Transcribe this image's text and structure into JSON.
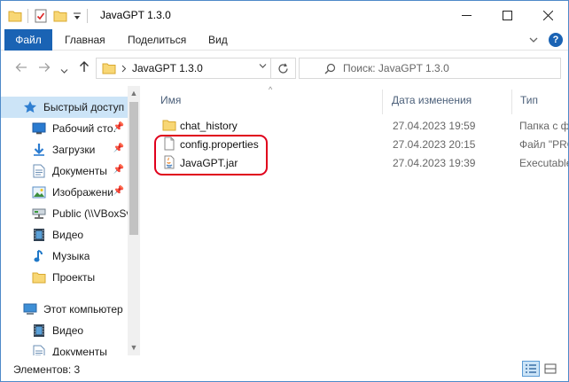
{
  "window": {
    "title": "JavaGPT 1.3.0"
  },
  "ribbon": {
    "file": "Файл",
    "tabs": [
      "Главная",
      "Поделиться",
      "Вид"
    ]
  },
  "nav": {
    "path": "JavaGPT 1.3.0",
    "search_placeholder": "Поиск: JavaGPT 1.3.0"
  },
  "sidebar": {
    "items": [
      {
        "label": "Быстрый доступ",
        "icon": "star-icon"
      },
      {
        "label": "Рабочий сто.",
        "icon": "desktop-icon"
      },
      {
        "label": "Загрузки",
        "icon": "download-icon"
      },
      {
        "label": "Документы",
        "icon": "documents-icon"
      },
      {
        "label": "Изображени",
        "icon": "pictures-icon"
      },
      {
        "label": "Public (\\\\VBoxSv",
        "icon": "network-drive-icon"
      },
      {
        "label": "Видео",
        "icon": "video-icon"
      },
      {
        "label": "Музыка",
        "icon": "music-icon"
      },
      {
        "label": "Проекты",
        "icon": "folder-icon"
      },
      {
        "label": "Этот компьютер",
        "icon": "computer-icon"
      },
      {
        "label": "Видео",
        "icon": "video-icon"
      },
      {
        "label": "Документы",
        "icon": "documents-icon"
      }
    ]
  },
  "columns": {
    "name": "Имя",
    "date": "Дата изменения",
    "type": "Тип"
  },
  "files": [
    {
      "name": "chat_history",
      "date": "27.04.2023 19:59",
      "type": "Папка с ф",
      "icon": "folder-icon"
    },
    {
      "name": "config.properties",
      "date": "27.04.2023 20:15",
      "type": "Файл \"PRO",
      "icon": "file-icon"
    },
    {
      "name": "JavaGPT.jar",
      "date": "27.04.2023 19:39",
      "type": "Executable",
      "icon": "java-jar-icon"
    }
  ],
  "status": {
    "count": "Элементов: 3"
  },
  "colors": {
    "accent": "#1a63b4",
    "selection": "#cce4f7",
    "highlight": "#e0001c",
    "folder": "#f8d775"
  }
}
